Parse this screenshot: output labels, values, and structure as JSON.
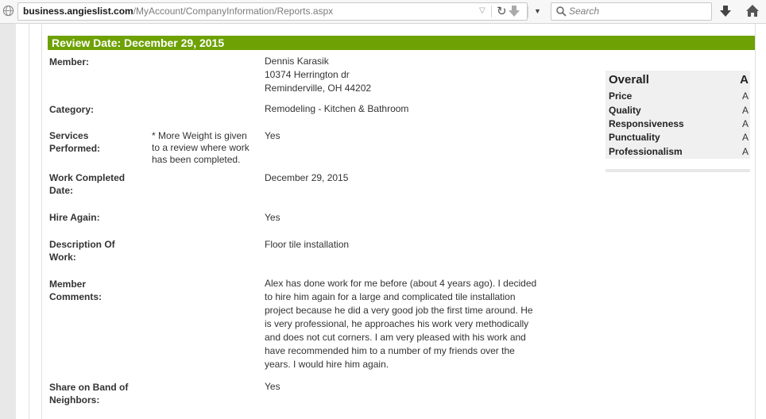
{
  "browser": {
    "url_host": "business.angieslist.com",
    "url_path": "/MyAccount/CompanyInformation/Reports.aspx",
    "search_placeholder": "Search"
  },
  "review": {
    "header": "Review Date: December 29, 2015",
    "member_label": "Member:",
    "member_name": "Dennis Karasik",
    "member_address1": "10374 Herrington dr",
    "member_address2": "Reminderville, OH 44202",
    "category_label": "Category:",
    "category_value": "Remodeling - Kitchen & Bathroom",
    "services_label": [
      "Services",
      "Performed:"
    ],
    "services_note": [
      "* More Weight is given",
      "to a review where work",
      "has been completed."
    ],
    "services_value": "Yes",
    "work_completed_label": [
      "Work Completed",
      "Date:"
    ],
    "work_completed_value": "December 29, 2015",
    "hire_again_label": "Hire Again:",
    "hire_again_value": "Yes",
    "description_label": [
      "Description Of",
      "Work:"
    ],
    "description_value": "Floor tile installation",
    "comments_label": [
      "Member",
      "Comments:"
    ],
    "comments_lines": [
      "Alex has done work for me before (about 4 years ago). I decided",
      "to hire him again for a large and complicated tile installation",
      "project because he did a very good job the first time around. He",
      "is very professional, he approaches his work very methodically",
      "and does not cut corners. I am very pleased with his work and",
      "have recommended him to a number of my friends over the",
      "years. I would hire him again."
    ],
    "share_label": [
      "Share on Band of",
      "Neighbors:"
    ],
    "share_value": "Yes"
  },
  "ratings": {
    "overall_label": "Overall",
    "overall_grade": "A",
    "items": [
      {
        "label": "Price",
        "grade": "A"
      },
      {
        "label": "Quality",
        "grade": "A"
      },
      {
        "label": "Responsiveness",
        "grade": "A"
      },
      {
        "label": "Punctuality",
        "grade": "A"
      },
      {
        "label": "Professionalism",
        "grade": "A"
      }
    ]
  },
  "colors": {
    "header_green": "#6ea103"
  },
  "icons": [
    "globe-icon",
    "dropdown-arrow-icon",
    "reload-icon",
    "download-icon",
    "menu-arrow-icon",
    "search-icon",
    "download-icon",
    "home-icon"
  ]
}
